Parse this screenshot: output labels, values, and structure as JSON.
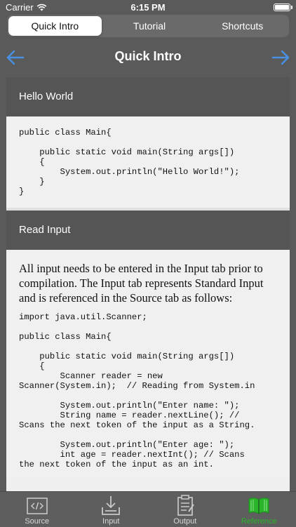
{
  "status_bar": {
    "carrier": "Carrier",
    "time": "6:15 PM"
  },
  "segments": [
    {
      "label": "Quick Intro",
      "active": true
    },
    {
      "label": "Tutorial",
      "active": false
    },
    {
      "label": "Shortcuts",
      "active": false
    }
  ],
  "nav": {
    "title": "Quick Intro",
    "back_icon": "arrow-left-icon",
    "forward_icon": "arrow-right-icon"
  },
  "sections": [
    {
      "title": "Hello World",
      "code": "public class Main{\n\n    public static void main(String args[])\n    {\n        System.out.println(\"Hello World!\");\n    }\n}"
    },
    {
      "title": "Read Input",
      "text": "All input needs to be entered in the Input tab prior to compilation. The Input tab represents Standard Input and is referenced in the Source tab as follows:",
      "code": "import java.util.Scanner;\n\npublic class Main{\n\n    public static void main(String args[])\n    {\n        Scanner reader = new\nScanner(System.in);  // Reading from System.in\n\n        System.out.println(\"Enter name: \");\n        String name = reader.nextLine(); //\nScans the next token of the input as a String.\n\n        System.out.println(\"Enter age: \");\n        int age = reader.nextInt(); // Scans\nthe next token of the input as an int."
    }
  ],
  "tabs": [
    {
      "label": "Source",
      "icon": "code-icon",
      "active": false
    },
    {
      "label": "Input",
      "icon": "download-icon",
      "active": false
    },
    {
      "label": "Output",
      "icon": "clipboard-icon",
      "active": false
    },
    {
      "label": "Reference",
      "icon": "book-icon",
      "active": true
    }
  ],
  "colors": {
    "accent_blue": "#4a90e2",
    "active_green": "#2ab52a",
    "header_gray": "#555555"
  }
}
